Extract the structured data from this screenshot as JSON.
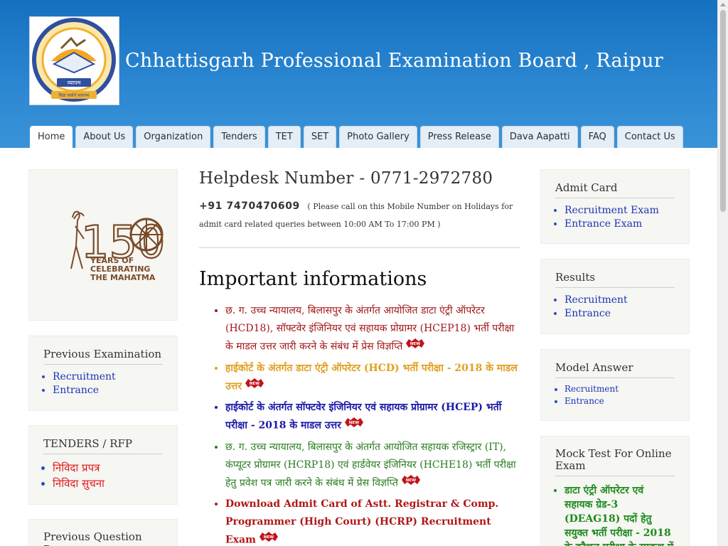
{
  "header": {
    "title": "Chhattisgarh Professional Examination Board , Raipur",
    "logo_text": "व्यापम",
    "logo_tagline": "विद्या सर्वार्थ साधनम"
  },
  "nav": {
    "tabs": [
      {
        "label": "Home",
        "active": true
      },
      {
        "label": "About Us",
        "active": false
      },
      {
        "label": "Organization",
        "active": false
      },
      {
        "label": "Tenders",
        "active": false
      },
      {
        "label": "TET",
        "active": false
      },
      {
        "label": "SET",
        "active": false
      },
      {
        "label": "Photo Gallery",
        "active": false
      },
      {
        "label": "Press Release",
        "active": false
      },
      {
        "label": "Dava Aapatti",
        "active": false
      },
      {
        "label": "FAQ",
        "active": false
      },
      {
        "label": "Contact Us",
        "active": false
      }
    ]
  },
  "left_sidebar": {
    "banner": {
      "line1": "YEARS OF",
      "line2": "CELEBRATING",
      "line3": "THE MAHATMA",
      "number": "150"
    },
    "previous_examination": {
      "title": "Previous Examination",
      "items": [
        "Recruitment",
        "Entrance"
      ]
    },
    "tenders": {
      "title": "TENDERS / RFP",
      "items": [
        "निविदा प्रपत्र",
        "निविदा सुचना"
      ]
    },
    "previous_question": {
      "title": "Previous Question P"
    }
  },
  "main": {
    "helpdesk": "Helpdesk Number - 0771-2972780",
    "mobile_number": "+91 7470470609",
    "mobile_note": "( Please call on this Mobile Number on Holidays for admit card related queries between 10:00 AM To 17:00 PM )",
    "heading": "Important informations",
    "badge_text": "NEW",
    "items": [
      {
        "text": "छ. ग. उच्च न्यायालय, बिलासपुर के अंतर्गत आयोजित डाटा एंट्री ऑपरेटर (HCD18), सॉफ्टवेर इंजिनियर एवं सहायक प्रोग्रामर (HCEP18) भर्ती परीक्षा के माडल उत्तर जारी करने के संबंध में प्रेस विज्ञप्ति",
        "color": "#a31414",
        "bold": false
      },
      {
        "text": "हाईकोर्ट के अंतर्गत डाटा एंट्री ऑपरेटर (HCD) भर्ती परीक्षा - 2018 के माडल उत्तर",
        "color": "#e0a020",
        "bold": true
      },
      {
        "text": "हाईकोर्ट के अंतर्गत सॉफ्टवेर इंजिनियर एवं सहायक प्रोग्रामर (HCEP) भर्ती परीक्षा - 2018 के माडल उत्तर",
        "color": "#1a1aa8",
        "bold": true
      },
      {
        "text": "छ. ग. उच्च न्यायालय, बिलासपुर के अंतर्गत आयोजित सहायक रजिस्ट्रार (IT), कंप्यूटर प्रोग्रामर (HCRP18) एवं हार्डवेयर इंजिनियर (HCHE18) भर्ती परीक्षा हेतु प्रवेश पत्र जारी करने के संबंध में प्रेस विज्ञप्ति",
        "color": "#2a7a20",
        "bold": false
      },
      {
        "text": "Download Admit Card of Astt. Registrar & Comp. Programmer (High Court) (HCRP) Recruitment Exam",
        "color": "#b01818",
        "bold": true
      }
    ]
  },
  "right_sidebar": {
    "admit_card": {
      "title": "Admit Card",
      "items": [
        "Recruitment Exam",
        "Entrance Exam"
      ]
    },
    "results": {
      "title": "Results",
      "items": [
        "Recruitment",
        "Entrance"
      ]
    },
    "model_answer": {
      "title": "Model Answer",
      "items": [
        "Recruitment",
        "Entrance"
      ]
    },
    "mock_test": {
      "title": "Mock Test For Online Exam",
      "item": "डाटा एंट्री ऑपरेटर एवं सहायक ग्रेड-3 (DEAG18) पदों हेतु सयुक्त भर्ती परीक्षा - 2018 के कौशल परीक्षा के सम्बन्ध में मॉक टेस्ट"
    }
  }
}
